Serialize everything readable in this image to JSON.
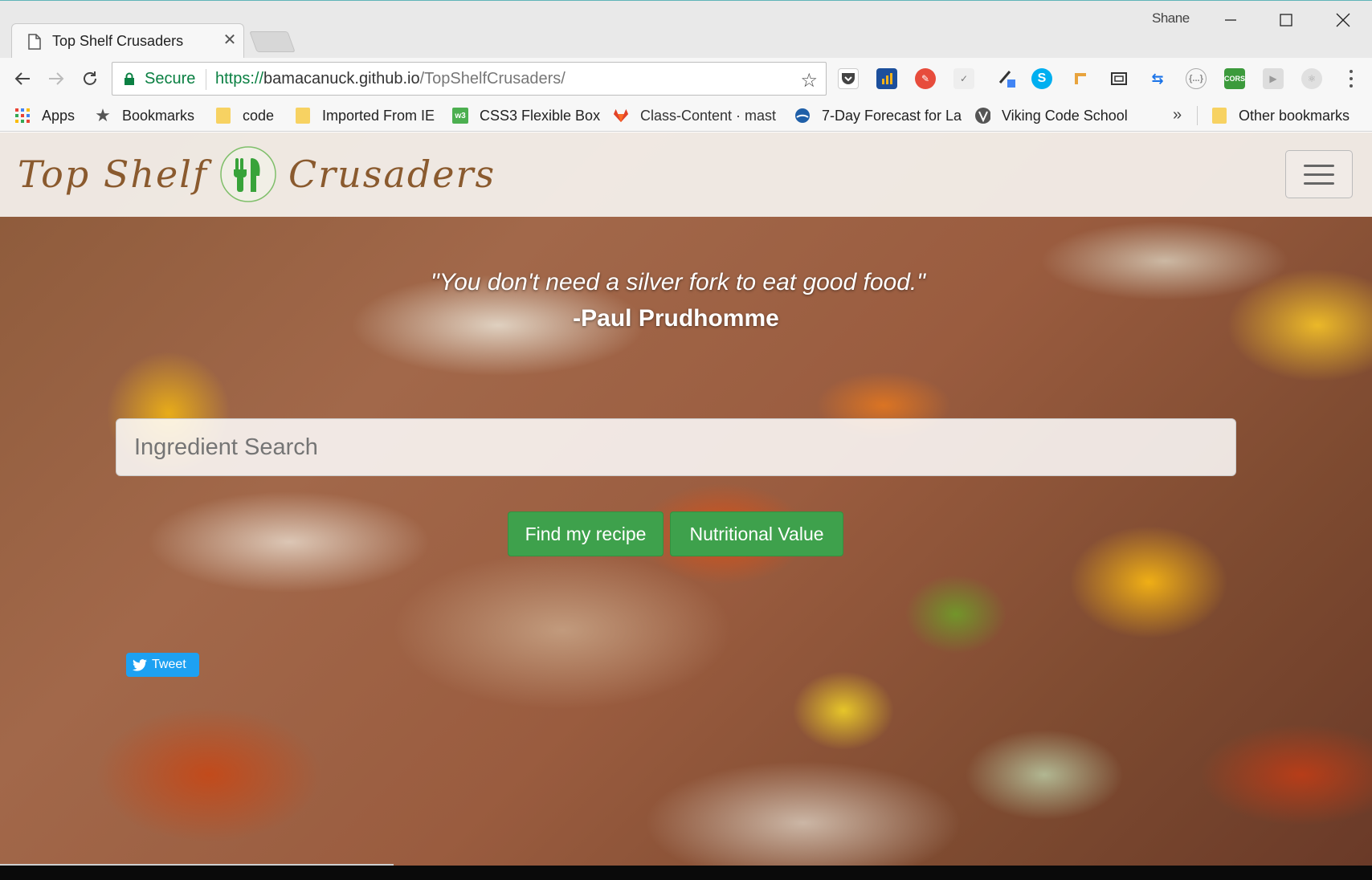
{
  "browser": {
    "tab_title": "Top Shelf Crusaders",
    "profile_name": "Shane",
    "security_label": "Secure",
    "url_scheme": "https://",
    "url_host": "bamacanuck.github.io",
    "url_path": "/TopShelfCrusaders/",
    "bookmarks": [
      {
        "label": "Apps",
        "icon": "apps-grid-icon"
      },
      {
        "label": "Bookmarks",
        "icon": "star-icon"
      },
      {
        "label": "code",
        "icon": "folder-icon"
      },
      {
        "label": "Imported From IE",
        "icon": "folder-icon"
      },
      {
        "label": "CSS3 Flexible Box",
        "icon": "w3-icon"
      },
      {
        "label": "Class-Content · mast",
        "icon": "gitlab-icon"
      },
      {
        "label": "7-Day Forecast for La",
        "icon": "noaa-icon"
      },
      {
        "label": "Viking Code School",
        "icon": "viking-icon"
      }
    ],
    "overflow_label": "»",
    "other_bookmarks": "Other bookmarks"
  },
  "page": {
    "brand_left": "Top Shelf",
    "brand_right": "Crusaders",
    "quote": "\"You don't need a silver fork to eat good food.\"",
    "author": "-Paul Prudhomme",
    "search_placeholder": "Ingredient Search",
    "find_button": "Find my recipe",
    "nutrition_button": "Nutritional Value",
    "tweet_button": "Tweet"
  },
  "colors": {
    "brand": "#8a5a2e",
    "button_green": "#3ea14c",
    "secure_green": "#0b8043",
    "tweet_blue": "#1da1f2"
  }
}
